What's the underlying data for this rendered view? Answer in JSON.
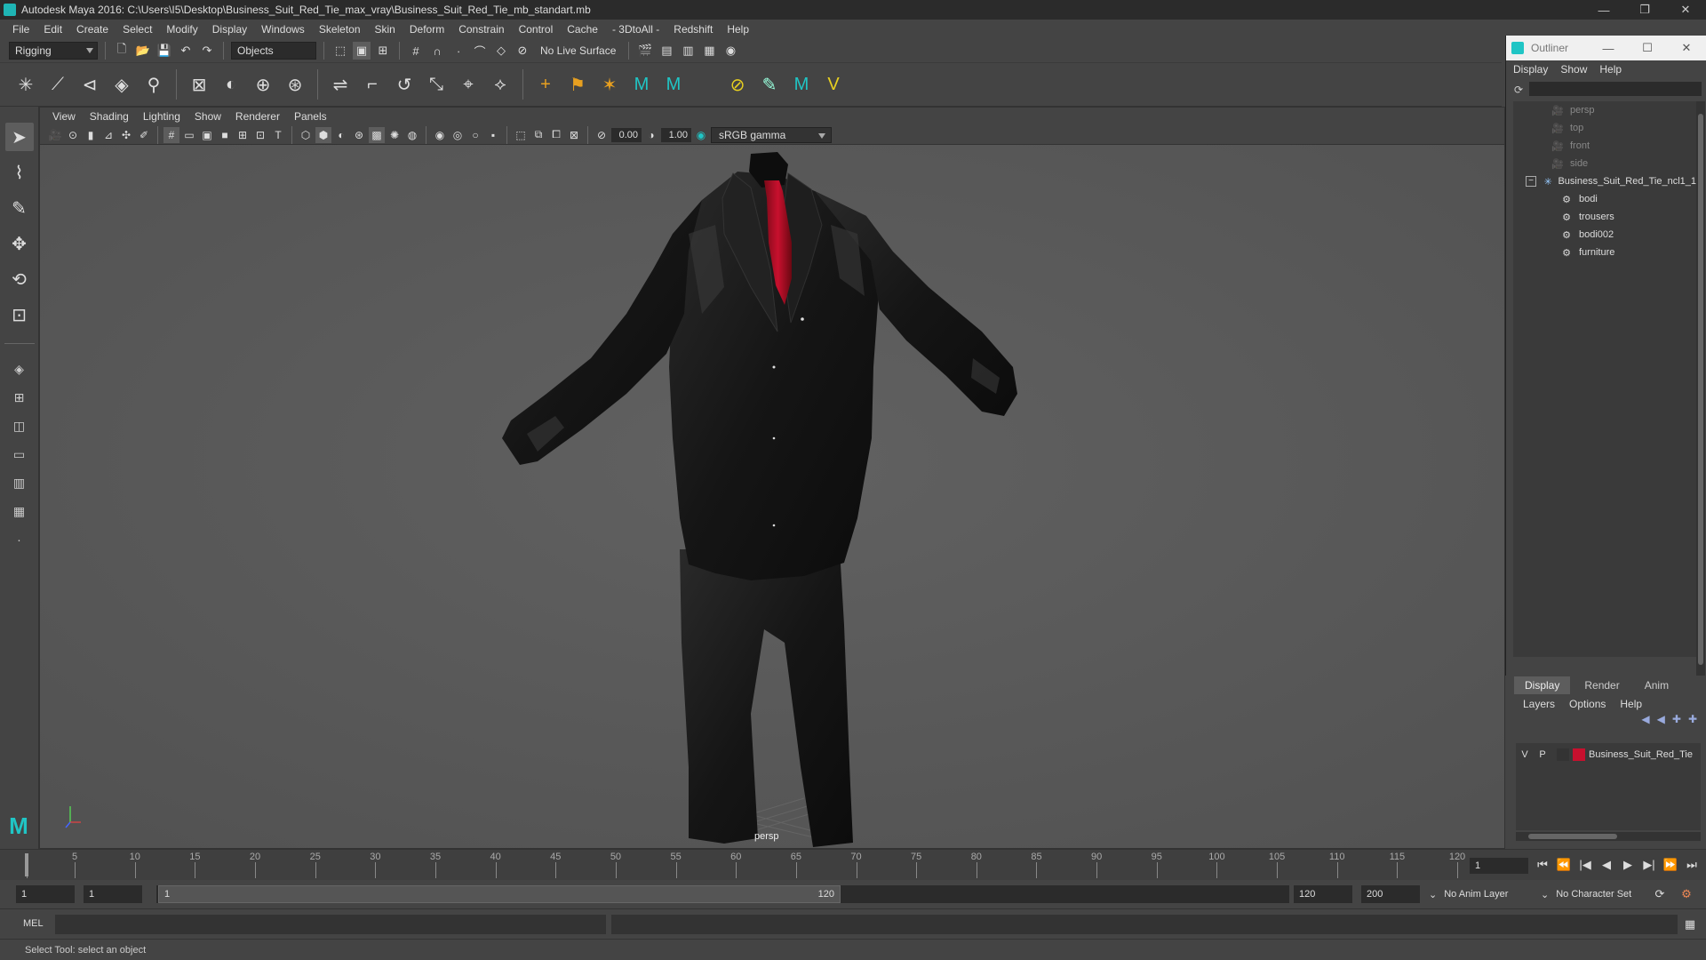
{
  "window": {
    "title": "Autodesk Maya 2016: C:\\Users\\I5\\Desktop\\Business_Suit_Red_Tie_max_vray\\Business_Suit_Red_Tie_mb_standart.mb",
    "minimize": "—",
    "restore": "❐",
    "close": "✕"
  },
  "menubar": [
    "File",
    "Edit",
    "Create",
    "Select",
    "Modify",
    "Display",
    "Windows",
    "Skeleton",
    "Skin",
    "Deform",
    "Constrain",
    "Control",
    "Cache",
    "- 3DtoAll -",
    "Redshift",
    "Help"
  ],
  "statusline": {
    "menuset": "Rigging",
    "select_mode": "Objects",
    "live_surface": "No Live Surface"
  },
  "viewport": {
    "menu": [
      "View",
      "Shading",
      "Lighting",
      "Show",
      "Renderer",
      "Panels"
    ],
    "exposure": "0.00",
    "gamma_value": "1.00",
    "color_space": "sRGB gamma",
    "camera": "persp"
  },
  "timeline": {
    "labels": [
      "1",
      "5",
      "10",
      "15",
      "20",
      "25",
      "30",
      "35",
      "40",
      "45",
      "50",
      "55",
      "60",
      "65",
      "70",
      "75",
      "80",
      "85",
      "90",
      "95",
      "100",
      "105",
      "110",
      "115",
      "120"
    ],
    "current_frame": "1"
  },
  "range": {
    "start": "1",
    "playback_start": "1",
    "handle_start": "1",
    "handle_end": "120",
    "playback_end": "120",
    "end": "200",
    "anim_layer": "No Anim Layer",
    "character_set": "No Character Set"
  },
  "cmdline": {
    "label": "MEL"
  },
  "helpline": {
    "text": "Select Tool: select an object"
  },
  "outliner": {
    "title": "Outliner",
    "menu": [
      "Display",
      "Show",
      "Help"
    ],
    "cameras": [
      "persp",
      "top",
      "front",
      "side"
    ],
    "group": "Business_Suit_Red_Tie_ncl1_1",
    "children": [
      "bodi",
      "trousers",
      "bodi002",
      "furniture"
    ]
  },
  "layer_editor": {
    "tabs": [
      "Display",
      "Render",
      "Anim"
    ],
    "menu": [
      "Layers",
      "Options",
      "Help"
    ],
    "layer": {
      "visible": "V",
      "playback": "P",
      "name": "Business_Suit_Red_Tie",
      "color": "#c8102e"
    }
  },
  "colors": {
    "accent": "#20c5c5",
    "tie": "#c8102e",
    "suit": "#161616"
  }
}
